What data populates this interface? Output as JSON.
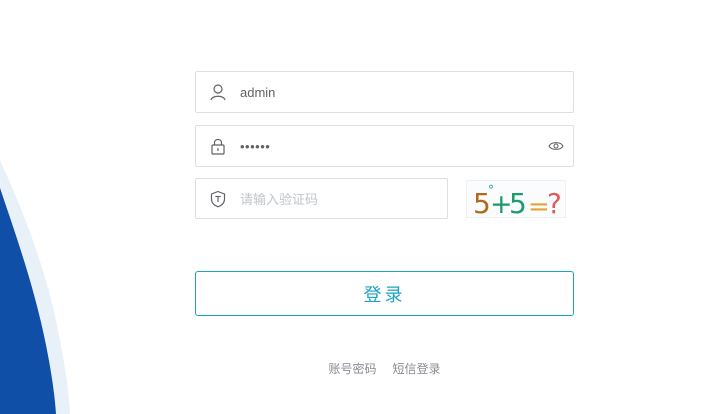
{
  "login_form": {
    "username": {
      "value": "admin",
      "icon": "user-icon"
    },
    "password": {
      "value": "••••••",
      "icon": "lock-icon",
      "toggle_icon": "eye-icon"
    },
    "captcha": {
      "placeholder": "请输入验证码",
      "icon": "shield-icon",
      "image_text": "5°+5=?"
    },
    "submit_label": "登录"
  },
  "alternate_logins": {
    "account_password": "账号密码",
    "sms_login": "短信登录"
  },
  "colors": {
    "accent": "#1ea3c4",
    "wave_blue": "#0f4fa8",
    "wave_light": "#e8f1f7",
    "border": "#dcdfe6"
  }
}
